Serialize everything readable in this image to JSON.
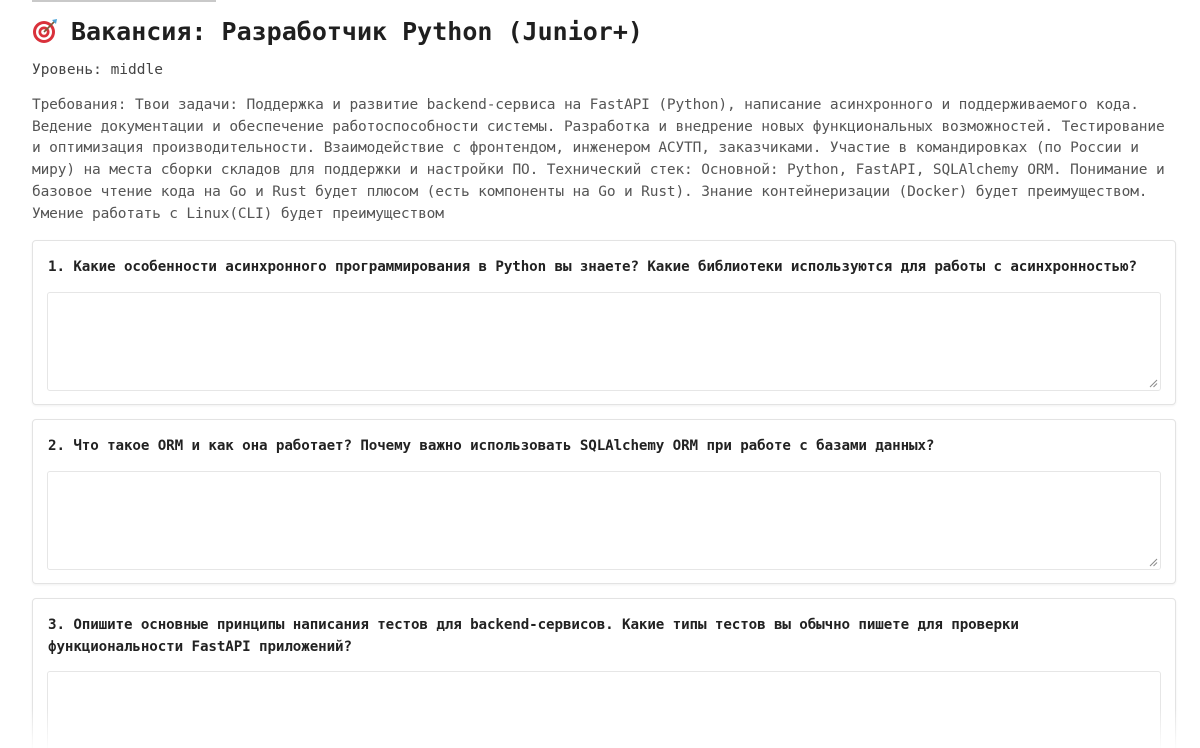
{
  "header": {
    "icon": "target-icon",
    "title": "Вакансия: Разработчик Python (Junior+)"
  },
  "level": "Уровень: middle",
  "requirements": "Требования: Твои задачи: Поддержка и развитие backend-сервиса на FastAPI (Python), написание асинхронного и поддерживаемого кода. Ведение документации и обеспечение работоспособности системы. Разработка и внедрение новых функциональных возможностей. Тестирование и оптимизация производительности. Взаимодействие с фронтендом, инженером АСУТП, заказчиками. Участие в командировках (по России и миру) на места сборки складов для поддержки и настройки ПО. Технический стек: Основной: Python, FastAPI, SQLAlchemy ORM. Понимание и базовое чтение кода на Go и Rust будет плюсом (есть компоненты на Go и Rust). Знание контейнеризации (Docker) будет преимуществом. Умение работать с Linux(CLI) будет преимуществом",
  "questions": [
    {
      "text": "1. Какие особенности асинхронного программирования в Python вы знаете? Какие библиотеки используются для работы с асинхронностью?",
      "answer": ""
    },
    {
      "text": "2. Что такое ORM и как она работает? Почему важно использовать SQLAlchemy ORM при работе с базами данных?",
      "answer": ""
    },
    {
      "text": "3. Опишите основные принципы написания тестов для backend-сервисов. Какие типы тестов вы обычно пишете для проверки функциональности FastAPI приложений?",
      "answer": ""
    }
  ],
  "colors": {
    "text": "#222222",
    "muted": "#555555",
    "border": "#e3e3e3",
    "icon_red": "#d9313b"
  }
}
